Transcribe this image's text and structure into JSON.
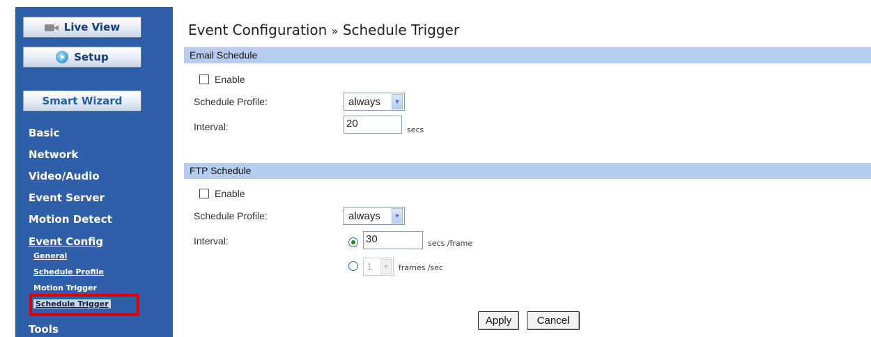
{
  "sidebar": {
    "live_view_label": "Live View",
    "setup_label": "Setup",
    "smart_wizard_label": "Smart Wizard",
    "menu": [
      "Basic",
      "Network",
      "Video/Audio",
      "Event Server",
      "Motion Detect",
      "Event Config",
      "Tools"
    ],
    "event_config_submenu": [
      "General",
      "Schedule Profile",
      "Motion Trigger",
      "Schedule Trigger"
    ],
    "active_item": "Schedule Trigger"
  },
  "page": {
    "title": "Event Configuration",
    "separator": "»",
    "subtitle": "Schedule Trigger"
  },
  "email_schedule": {
    "header": "Email Schedule",
    "enable_label": "Enable",
    "enabled": false,
    "profile_label": "Schedule Profile:",
    "profile_value": "always",
    "interval_label": "Interval:",
    "interval_value": "20",
    "interval_unit": "secs"
  },
  "ftp_schedule": {
    "header": "FTP Schedule",
    "enable_label": "Enable",
    "enabled": false,
    "profile_label": "Schedule Profile:",
    "profile_value": "always",
    "interval_label": "Interval:",
    "interval_secs_value": "30",
    "interval_secs_unit": "secs /frame",
    "interval_frames_value": "1",
    "interval_frames_unit": "frames /sec",
    "selected_mode": "secs"
  },
  "actions": {
    "apply_label": "Apply",
    "cancel_label": "Cancel"
  },
  "colors": {
    "sidebar_bg": "#2f5fa8",
    "section_bar": "#b7cdef",
    "highlight_border": "#e00000"
  }
}
